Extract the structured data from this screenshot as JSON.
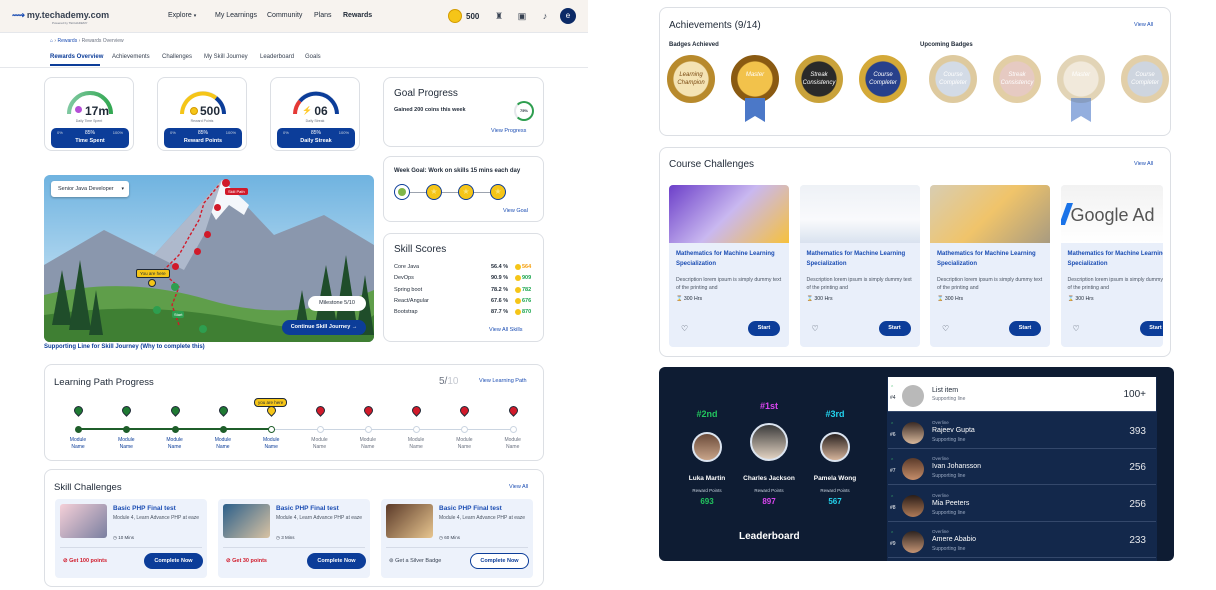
{
  "header": {
    "logo_text": "my.techademy.com",
    "logo_sub": "Powered by TECHADEMY",
    "nav": [
      "Explore",
      "My Learnings",
      "Community",
      "Plans",
      "Rewards"
    ],
    "coins": "500",
    "avatar_initial": "e"
  },
  "breadcrumb": [
    "Rewards",
    "Rewards Overview"
  ],
  "tabs": [
    "Rewards Overview",
    "Achievements",
    "Challenges",
    "My Skill Journey",
    "Leaderboard",
    "Goals"
  ],
  "gauges": [
    {
      "value": "17m",
      "sub": "Daily Time Spent",
      "label": "Time Spent",
      "min": "0%",
      "pct": "85%",
      "max": "100%",
      "fraction": 0.85
    },
    {
      "value": "500",
      "sub": "Reward Points",
      "label": "Reward Points",
      "min": "0%",
      "pct": "85%",
      "max": "100%",
      "fraction": 0.85
    },
    {
      "value": "06",
      "sub": "Daily Streak",
      "label": "Daily Streak",
      "min": "0%",
      "pct": "85%",
      "max": "100%",
      "fraction": 0.85
    }
  ],
  "goal_progress": {
    "title": "Goal Progress",
    "text": "Gained 200 coins this week",
    "pct": "75%",
    "link": "View Progress"
  },
  "week_goal": {
    "text": "Week Goal: Work on skills 15 mins each day",
    "link": "View Goal"
  },
  "skill_scores": {
    "title": "Skill Scores",
    "rows": [
      {
        "name": "Core Java",
        "pct": "56.4 %",
        "pts": "564",
        "color": "#f59e0b"
      },
      {
        "name": "DevOps",
        "pct": "90.9 %",
        "pts": "909",
        "color": "#16a34a"
      },
      {
        "name": "Spring boot",
        "pct": "78.2 %",
        "pts": "782",
        "color": "#16a34a"
      },
      {
        "name": "React/Angular",
        "pct": "67.6 %",
        "pts": "676",
        "color": "#16a34a"
      },
      {
        "name": "Bootstrap",
        "pct": "87.7 %",
        "pts": "870",
        "color": "#16a34a"
      }
    ],
    "link": "View All Skills"
  },
  "journey": {
    "role": "Senior Java Developer",
    "milestone": "Milestone 5/10",
    "cta": "Continue Skill Journey",
    "you_are_here": "You are here",
    "start": "Start",
    "goal_tag": "Skill Path",
    "supporting": "Supporting Line for Skill Journey (Why to complete this)"
  },
  "learning_path": {
    "title": "Learning Path Progress",
    "count_done": "5/",
    "count_total": "10",
    "link": "View Learning Path",
    "you_are_here": "you are here",
    "modules": [
      "Module Name",
      "Module Name",
      "Module Name",
      "Module Name",
      "Module Name",
      "Module Name",
      "Module Name",
      "Module Name",
      "Module Name",
      "Module Name"
    ]
  },
  "skill_challenges": {
    "title": "Skill Challenges",
    "link": "View All",
    "items": [
      {
        "title": "Basic PHP Final test",
        "desc": "Module 4, Learn Advance PHP at eaze",
        "time": "10 Mins",
        "reward": "Get 100 points",
        "cta": "Complete Now"
      },
      {
        "title": "Basic PHP Final test",
        "desc": "Module 4, Learn Advance PHP at eaze",
        "time": "3 Mins",
        "reward": "Get 30 points",
        "cta": "Complete Now"
      },
      {
        "title": "Basic PHP Final test",
        "desc": "Module 4, Learn Advance PHP at eaze",
        "time": "60 Mins",
        "reward": "Get a Silver Badge",
        "cta": "Complete Now"
      }
    ]
  },
  "achievements": {
    "title": "Achievements (9/14)",
    "link": "View All",
    "achieved_label": "Badges Achieved",
    "upcoming_label": "Upcoming Badges",
    "badges": [
      "Learning Champion",
      "Master",
      "Streak Consistency",
      "Course Completer",
      "Course Completer",
      "Streak Consistency",
      "Master",
      "Course Completer"
    ]
  },
  "course_challenges": {
    "title": "Course Challenges",
    "link": "View All",
    "items": [
      {
        "title": "Mathematics for Machine Learning Specialization",
        "desc": "Description lorem ipsum is simply dummy text of the printing and",
        "hrs": "300 Hrs",
        "cta": "Start"
      },
      {
        "title": "Mathematics for Machine Learning Specialization",
        "desc": "Description lorem ipsum is simply dummy text of the printing and",
        "hrs": "300 Hrs",
        "cta": "Start"
      },
      {
        "title": "Mathematics for Machine Learning Specialization",
        "desc": "Description lorem ipsum is simply dummy text of the printing and",
        "hrs": "300 Hrs",
        "cta": "Start"
      },
      {
        "title": "Mathematics for Machine Learning Specialization",
        "desc": "Description lorem ipsum is simply dummy text of the printing and",
        "hrs": "300 Hrs",
        "cta": "Start"
      }
    ],
    "google_text": "Google Ad"
  },
  "leaderboard": {
    "title": "Leaderboard",
    "podium": [
      {
        "rank": "#2nd",
        "name": "Luka Martin",
        "label": "Reward Points",
        "pts": "693",
        "color": "#22c55e"
      },
      {
        "rank": "#1st",
        "name": "Charles Jackson",
        "label": "Reward Points",
        "pts": "897",
        "color": "#d946ef"
      },
      {
        "rank": "#3rd",
        "name": "Pamela Wong",
        "label": "Reward Points",
        "pts": "567",
        "color": "#22d3ee"
      }
    ],
    "list": [
      {
        "rank": "#4",
        "overline": "",
        "name": "List item",
        "support": "Supporting line",
        "score": "100+"
      },
      {
        "rank": "#6",
        "overline": "Overline",
        "name": "Rajeev Gupta",
        "support": "Supporting line",
        "score": "393"
      },
      {
        "rank": "#7",
        "overline": "Overline",
        "name": "Ivan Johansson",
        "support": "Supporting line",
        "score": "256"
      },
      {
        "rank": "#8",
        "overline": "Overline",
        "name": "Mia Peeters",
        "support": "Supporting line",
        "score": "256"
      },
      {
        "rank": "#9",
        "overline": "Overline",
        "name": "Amere Ababio",
        "support": "Supporting line",
        "score": "233"
      }
    ]
  }
}
